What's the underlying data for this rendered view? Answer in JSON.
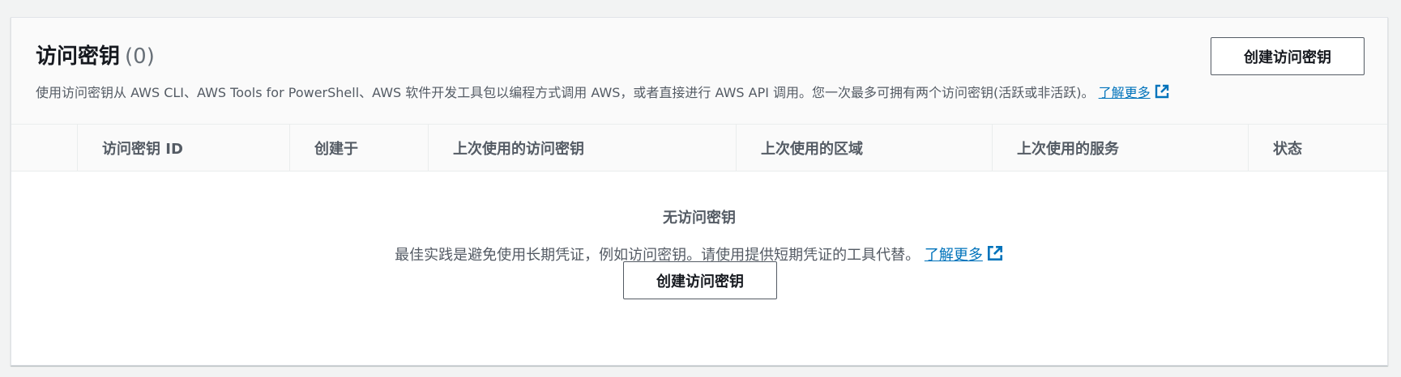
{
  "panel": {
    "title": "访问密钥",
    "count": "(0)",
    "description": "使用访问密钥从 AWS CLI、AWS Tools for PowerShell、AWS 软件开发工具包以编程方式调用 AWS，或者直接进行 AWS API 调用。您一次最多可拥有两个访问密钥(活跃或非活跃)。",
    "learn_more": "了解更多",
    "create_button": "创建访问密钥"
  },
  "table": {
    "columns": [
      "访问密钥 ID",
      "创建于",
      "上次使用的访问密钥",
      "上次使用的区域",
      "上次使用的服务",
      "状态"
    ]
  },
  "empty_state": {
    "title": "无访问密钥",
    "description": "最佳实践是避免使用长期凭证，例如访问密钥。请使用提供短期凭证的工具代替。",
    "learn_more": "了解更多",
    "create_button": "创建访问密钥"
  },
  "icons": {
    "external_link": "external-link-icon"
  },
  "colors": {
    "link": "#0073bb",
    "button_border": "#545b64",
    "background": "#f2f3f3"
  }
}
